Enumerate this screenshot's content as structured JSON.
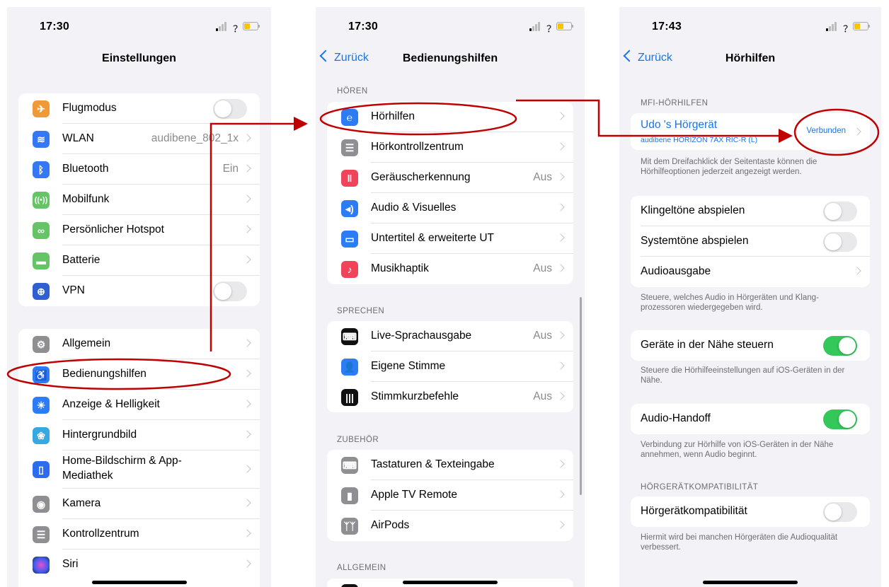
{
  "colors": {
    "accent": "#1b74e8",
    "toggle_on": "#34c759",
    "annotation": "#c00000",
    "background": "#f2f2f7"
  },
  "screen1": {
    "time": "17:30",
    "title": "Einstellungen",
    "group1": [
      {
        "label": "Flugmodus",
        "icon": "airplane-icon",
        "color": "#f09a37",
        "toggle": false
      },
      {
        "label": "WLAN",
        "icon": "wifi-icon",
        "color": "#3478f6",
        "value": "audibene_802_1x"
      },
      {
        "label": "Bluetooth",
        "icon": "bluetooth-icon",
        "color": "#3478f6",
        "value": "Ein"
      },
      {
        "label": "Mobilfunk",
        "icon": "antenna-icon",
        "color": "#65c466"
      },
      {
        "label": "Persönlicher Hotspot",
        "icon": "hotspot-icon",
        "color": "#65c466"
      },
      {
        "label": "Batterie",
        "icon": "battery-icon",
        "color": "#65c466"
      },
      {
        "label": "VPN",
        "icon": "vpn-globe-icon",
        "color": "#2f5fd0",
        "toggle": false
      }
    ],
    "group2": [
      {
        "label": "Allgemein",
        "icon": "gear-icon",
        "color": "#8e8e93"
      },
      {
        "label": "Bedienungshilfen",
        "icon": "accessibility-icon",
        "color": "#2c7cf6"
      },
      {
        "label": "Anzeige & Helligkeit",
        "icon": "sun-icon",
        "color": "#2c7cf6"
      },
      {
        "label": "Hintergrundbild",
        "icon": "flower-icon",
        "color": "#36a9e0"
      },
      {
        "label": "Home-Bildschirm & App-",
        "label2": "Mediathek",
        "icon": "homescreen-icon",
        "color": "#2c6df0"
      },
      {
        "label": "Kamera",
        "icon": "camera-icon",
        "color": "#8e8e93"
      },
      {
        "label": "Kontrollzentrum",
        "icon": "switches-icon",
        "color": "#8e8e93"
      },
      {
        "label": "Siri",
        "icon": "siri-icon",
        "color": "#222222"
      }
    ]
  },
  "screen2": {
    "time": "17:30",
    "back": "Zurück",
    "title": "Bedienungshilfen",
    "sections": [
      {
        "header": "HÖREN",
        "items": [
          {
            "label": "Hörhilfen",
            "icon": "ear-icon",
            "color": "#2c7cf6"
          },
          {
            "label": "Hörkontrollzentrum",
            "icon": "switches-icon",
            "color": "#8e8e93"
          },
          {
            "label": "Geräuscherkennung",
            "icon": "sound-recognition-icon",
            "color": "#f0445a",
            "value": "Aus"
          },
          {
            "label": "Audio & Visuelles",
            "icon": "speaker-eye-icon",
            "color": "#2c7cf6"
          },
          {
            "label": "Untertitel & erweiterte UT",
            "icon": "subtitles-icon",
            "color": "#2c7cf6"
          },
          {
            "label": "Musikhaptik",
            "icon": "haptics-icon",
            "color": "#f0445a",
            "value": "Aus"
          }
        ]
      },
      {
        "header": "SPRECHEN",
        "items": [
          {
            "label": "Live-Sprachausgabe",
            "icon": "keyboard-speech-icon",
            "color": "#111111",
            "value": "Aus"
          },
          {
            "label": "Eigene Stimme",
            "icon": "person-voice-icon",
            "color": "#2c7cf6"
          },
          {
            "label": "Stimmkurzbefehle",
            "icon": "waveform-icon",
            "color": "#111111",
            "value": "Aus"
          }
        ]
      },
      {
        "header": "ZUBEHÖR",
        "items": [
          {
            "label": "Tastaturen & Texteingabe",
            "icon": "keyboard-icon",
            "color": "#8e8e93"
          },
          {
            "label": "Apple TV Remote",
            "icon": "remote-icon",
            "color": "#8e8e93"
          },
          {
            "label": "AirPods",
            "icon": "airpods-icon",
            "color": "#8e8e93"
          }
        ]
      },
      {
        "header": "ALLGEMEIN",
        "items": []
      }
    ]
  },
  "screen3": {
    "time": "17:43",
    "back": "Zurück",
    "title": "Hörhilfen",
    "mfi_header": "MFI-HÖRHILFEN",
    "device_name": "Udo 's Hörgerät",
    "device_model": "audibene HORIZON 7AX RIC-R (L)",
    "device_status": "Verbunden",
    "mfi_footer": "Mit dem Dreifachklick der Seitentaste können die Hörhilfeoptionen jederzeit angezeigt werden.",
    "audio_rows": [
      {
        "label": "Klingeltöne abspielen",
        "toggle": false
      },
      {
        "label": "Systemtöne abspielen",
        "toggle": false
      },
      {
        "label": "Audioausgabe",
        "chevron": true
      }
    ],
    "audio_footer": "Steuere, welches Audio in Hörgeräten und Klang­prozessoren wiedergegeben wird.",
    "nearby_label": "Geräte in der Nähe steuern",
    "nearby_toggle": true,
    "nearby_footer": "Steuere die Hörhilfeeinstellungen auf iOS-Geräten in der Nähe.",
    "handoff_label": "Audio-Handoff",
    "handoff_toggle": true,
    "handoff_footer": "Verbindung zur Hörhilfe von iOS-Geräten in der Nähe annehmen, wenn Audio beginnt.",
    "compat_header": "HÖRGERÄTKOMPATIBILITÄT",
    "compat_label": "Hörgerätkompatibilität",
    "compat_toggle": false,
    "compat_footer": "Hiermit wird bei manchen Hörgeräten die Audio­qualität verbessert."
  }
}
